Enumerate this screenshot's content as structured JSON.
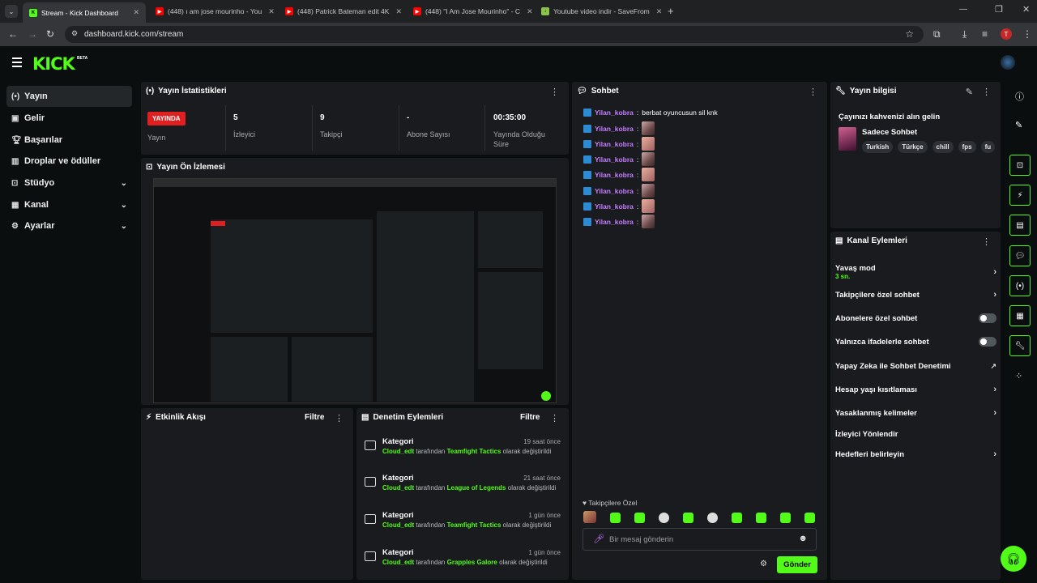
{
  "browser": {
    "tabs": [
      {
        "title": "Stream - Kick Dashboard",
        "active": true
      },
      {
        "title": "(448) ı am jose mourinho - You",
        "active": false
      },
      {
        "title": "(448) Patrick Bateman edit 4K",
        "active": false
      },
      {
        "title": "(448) \"I Am Jose Mourinho\" - C",
        "active": false
      },
      {
        "title": "Youtube video indir - SaveFrom",
        "active": false
      }
    ],
    "url": "dashboard.kick.com/stream",
    "profile_initial": "T"
  },
  "app": {
    "logo": "KICK",
    "logo_badge": "BETA"
  },
  "sidebar": {
    "items": [
      {
        "label": "Yayın",
        "icon": "broadcast-icon",
        "active": true
      },
      {
        "label": "Gelir",
        "icon": "revenue-icon"
      },
      {
        "label": "Başarılar",
        "icon": "trophy-icon"
      },
      {
        "label": "Droplar ve ödüller",
        "icon": "drops-icon"
      },
      {
        "label": "Stüdyo",
        "icon": "studio-icon",
        "expandable": true
      },
      {
        "label": "Kanal",
        "icon": "channel-icon",
        "expandable": true
      },
      {
        "label": "Ayarlar",
        "icon": "settings-icon",
        "expandable": true
      }
    ]
  },
  "stats": {
    "title": "Yayın İstatistikleri",
    "live_badge": "YAYINDA",
    "live_label": "Yayın",
    "viewers": {
      "value": "5",
      "label": "İzleyici"
    },
    "followers": {
      "value": "9",
      "label": "Takipçi"
    },
    "subscribers": {
      "value": "-",
      "label": "Abone Sayısı"
    },
    "uptime": {
      "value": "00:35:00",
      "label": "Yayında Olduğu Süre"
    }
  },
  "preview": {
    "title": "Yayın Ön İzlemesi"
  },
  "activity": {
    "title": "Etkinlik Akışı",
    "filter": "Filtre"
  },
  "moderation": {
    "title": "Denetim Eylemleri",
    "filter": "Filtre",
    "rows": [
      {
        "title": "Kategori",
        "time": "19 saat önce",
        "user": "Cloud_edt",
        "mid": "tarafından",
        "game": "Teamfight Tactics",
        "end": "olarak değiştirildi"
      },
      {
        "title": "Kategori",
        "time": "21 saat önce",
        "user": "Cloud_edt",
        "mid": "tarafından",
        "game": "League of Legends",
        "end": "olarak değiştirildi"
      },
      {
        "title": "Kategori",
        "time": "1 gün önce",
        "user": "Cloud_edt",
        "mid": "tarafından",
        "game": "Teamfight Tactics",
        "end": "olarak değiştirildi"
      },
      {
        "title": "Kategori",
        "time": "1 gün önce",
        "user": "Cloud_edt",
        "mid": "tarafından",
        "game": "Grapples Galore",
        "end": "olarak değiştirildi"
      }
    ]
  },
  "chat": {
    "title": "Sohbet",
    "messages": [
      {
        "user": "Yilan_kobra",
        "text": "berbat oyuncusun sil knk"
      },
      {
        "user": "Yilan_kobra",
        "text": ""
      },
      {
        "user": "Yilan_kobra",
        "text": ""
      },
      {
        "user": "Yilan_kobra",
        "text": ""
      },
      {
        "user": "Yilan_kobra",
        "text": ""
      },
      {
        "user": "Yilan_kobra",
        "text": ""
      },
      {
        "user": "Yilan_kobra",
        "text": ""
      },
      {
        "user": "Yilan_kobra",
        "text": ""
      }
    ],
    "followers_only": "Takipçilere Özel",
    "input_placeholder": "Bir mesaj gönderin",
    "send": "Gönder"
  },
  "stream_info": {
    "title": "Yayın bilgisi",
    "stream_title": "Çayınızı kahvenizi alın gelin",
    "category": "Sadece Sohbet",
    "tags": [
      "Turkish",
      "Türkçe",
      "chill",
      "fps",
      "fu"
    ]
  },
  "channel_actions": {
    "title": "Kanal Eylemleri",
    "slow_mode": "Yavaş mod",
    "slow_mode_value": "3 sn.",
    "followers_chat": "Takipçilere özel sohbet",
    "subscribers_chat": "Abonelere özel sohbet",
    "emotes_only": "Yalnızca ifadelerle sohbet",
    "ai_moderation": "Yapay Zeka ile Sohbet Denetimi",
    "age_restriction": "Hesap yaşı kısıtlaması",
    "banned_words": "Yasaklanmış kelimeler",
    "redirect": "İzleyici Yönlendir",
    "goals": "Hedefleri belirleyin"
  },
  "colors": {
    "accent": "#53fc18",
    "live": "#e01f20",
    "panel": "#191b1f",
    "bg": "#0b0e0f"
  }
}
